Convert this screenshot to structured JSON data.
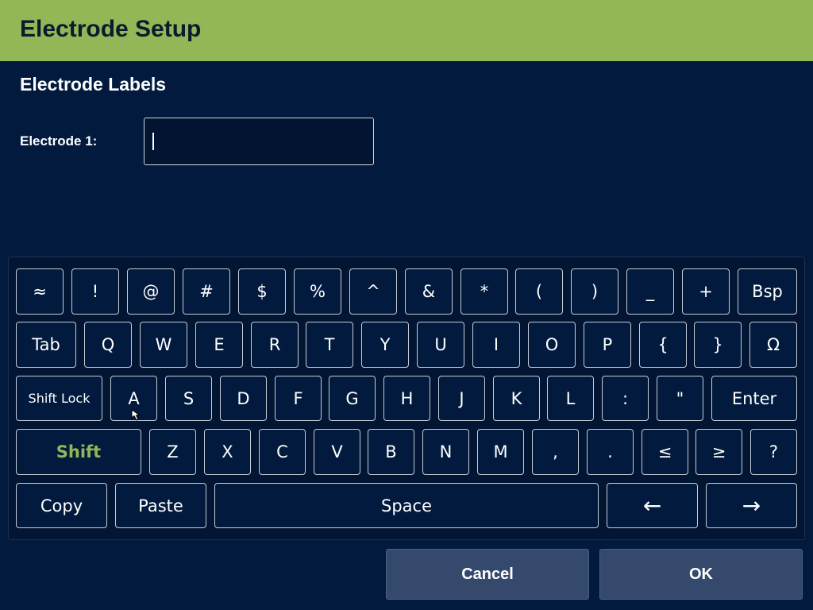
{
  "header": {
    "title": "Electrode Setup"
  },
  "section": {
    "title": "Electrode Labels"
  },
  "field": {
    "label": "Electrode 1:",
    "value": ""
  },
  "keyboard": {
    "row1": [
      "≈",
      "!",
      "@",
      "#",
      "$",
      "%",
      "^",
      "&",
      "*",
      "(",
      ")",
      "_",
      "+",
      "Bsp"
    ],
    "row2": [
      "Tab",
      "Q",
      "W",
      "E",
      "R",
      "T",
      "Y",
      "U",
      "I",
      "O",
      "P",
      "{",
      "}",
      "Ω"
    ],
    "row3": [
      "Shift Lock",
      "A",
      "S",
      "D",
      "F",
      "G",
      "H",
      "J",
      "K",
      "L",
      ":",
      "\"",
      "Enter"
    ],
    "row4": [
      "Shift",
      "Z",
      "X",
      "C",
      "V",
      "B",
      "N",
      "M",
      ",",
      ".",
      "≤",
      "≥",
      "?"
    ],
    "row5": [
      "Copy",
      "Paste",
      "Space",
      "←",
      "→"
    ]
  },
  "buttons": {
    "cancel": "Cancel",
    "ok": "OK"
  },
  "colors": {
    "background": "#011a3e",
    "header": "#93b656",
    "shift_text": "#93b656",
    "button": "#34496c"
  }
}
